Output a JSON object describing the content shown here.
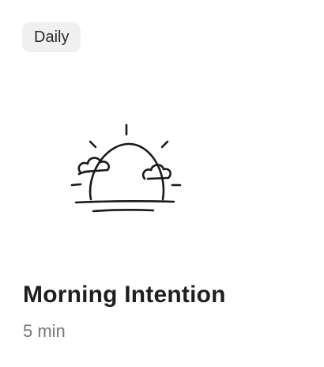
{
  "card": {
    "badge_label": "Daily",
    "illustration_icon": "sunrise-with-clouds-icon",
    "title": "Morning Intention",
    "duration": "5 min"
  },
  "colors": {
    "badge_background": "#f0f0f0",
    "title_text": "#1f1f1f",
    "duration_text": "#777777",
    "illustration_stroke": "#1a1a1a"
  }
}
